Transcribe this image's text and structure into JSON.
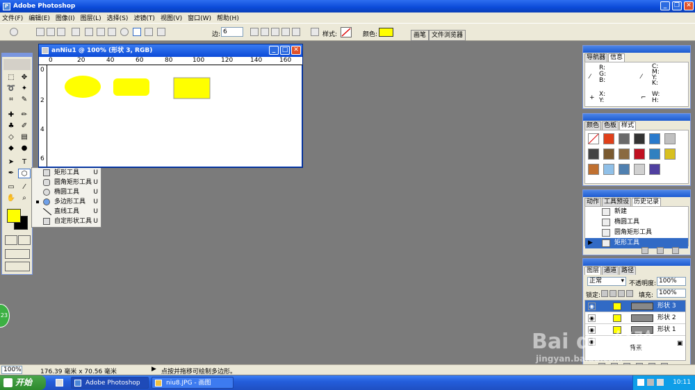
{
  "app": {
    "title": "Adobe Photoshop"
  },
  "menu": [
    "文件(F)",
    "编辑(E)",
    "图像(I)",
    "图层(L)",
    "选择(S)",
    "滤镜(T)",
    "视图(V)",
    "窗口(W)",
    "帮助(H)"
  ],
  "options": {
    "sides_label": "边:",
    "sides_value": "6",
    "style_label": "样式:",
    "color_label": "颜色:",
    "color": "#ffff00"
  },
  "palette_well": [
    "画笔",
    "文件浏览器"
  ],
  "document": {
    "title": "anNiu1 @ 100% (形状 3, RGB)",
    "ruler_marks": [
      "0",
      "20",
      "40",
      "60",
      "80",
      "100",
      "120",
      "140",
      "160"
    ],
    "v_ruler_marks": [
      "0",
      "2",
      "4",
      "6"
    ],
    "shapes": [
      {
        "kind": "ellipse",
        "color": "#ffff00"
      },
      {
        "kind": "rounded-rect",
        "color": "#ffff00"
      },
      {
        "kind": "rect",
        "color": "#ffff00"
      }
    ]
  },
  "flyout": [
    {
      "label": "矩形工具",
      "key": "U",
      "selected": false
    },
    {
      "label": "圆角矩形工具",
      "key": "U",
      "selected": false
    },
    {
      "label": "椭圆工具",
      "key": "U",
      "selected": false
    },
    {
      "label": "多边形工具",
      "key": "U",
      "selected": true
    },
    {
      "label": "直线工具",
      "key": "U",
      "selected": false
    },
    {
      "label": "自定形状工具",
      "key": "U",
      "selected": false
    }
  ],
  "navigator": {
    "tabs": [
      "导航器",
      "信息"
    ],
    "active": 1,
    "rgb": "R:\nG:\nB:",
    "cmyk": "C:\nM:\nY:\nK:",
    "xy": "X:\nY:",
    "wh": "W:\nH:"
  },
  "color_panel": {
    "tabs": [
      "颜色",
      "色板",
      "样式"
    ],
    "active": 2
  },
  "history": {
    "tabs": [
      "动作",
      "工具预设",
      "历史记录"
    ],
    "active": 2,
    "items": [
      {
        "label": "新建",
        "selected": false
      },
      {
        "label": "椭圆工具",
        "selected": false
      },
      {
        "label": "圆角矩形工具",
        "selected": false
      },
      {
        "label": "矩形工具",
        "selected": true
      }
    ]
  },
  "layers": {
    "tabs": [
      "图层",
      "通道",
      "路径"
    ],
    "active": 0,
    "blend": "正常",
    "opacity_label": "不透明度:",
    "opacity": "100%",
    "lock_label": "锁定:",
    "fill_label": "填充:",
    "fill": "100%",
    "items": [
      {
        "name": "形状 3",
        "selected": true
      },
      {
        "name": "形状 2",
        "selected": false
      },
      {
        "name": "形状 1",
        "selected": false
      }
    ],
    "background": "背景"
  },
  "status": {
    "zoom": "100%",
    "size": "176.39 毫米 x 70.56 毫米",
    "hint": "点按并拖移可绘制多边形。"
  },
  "taskbar": {
    "start": "开始",
    "tasks": [
      "Adobe Photoshop",
      "niu8.JPG - 画图"
    ],
    "time": "10:11"
  },
  "watermark": {
    "logo": "Bai du 经验",
    "url": "jingyan.baidu.com"
  },
  "badge": "23"
}
